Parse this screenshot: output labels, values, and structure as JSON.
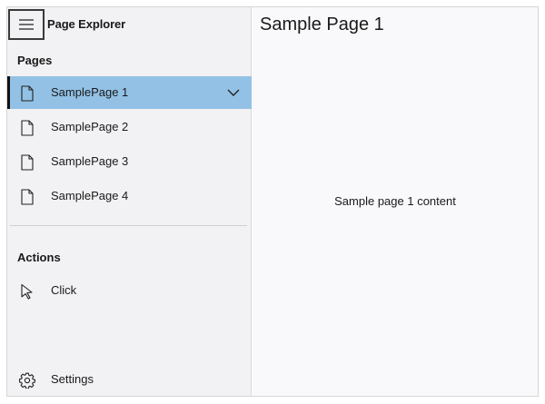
{
  "app": {
    "title": "Page Explorer"
  },
  "nav": {
    "pages_header": "Pages",
    "pages": [
      {
        "label": "SamplePage 1",
        "icon": "page-icon",
        "selected": true
      },
      {
        "label": "SamplePage 2",
        "icon": "page-icon",
        "selected": false
      },
      {
        "label": "SamplePage 3",
        "icon": "page-icon",
        "selected": false
      },
      {
        "label": "SamplePage 4",
        "icon": "page-icon",
        "selected": false
      }
    ],
    "actions_header": "Actions",
    "actions": [
      {
        "label": "Click",
        "icon": "cursor-icon"
      }
    ],
    "settings_label": "Settings",
    "settings_icon": "gear-icon"
  },
  "content": {
    "title": "Sample Page 1",
    "body": "Sample page 1 content"
  },
  "colors": {
    "selected_background": "#92c1e5",
    "nav_background": "#f2f1f3",
    "content_background": "#f9f8fa"
  }
}
